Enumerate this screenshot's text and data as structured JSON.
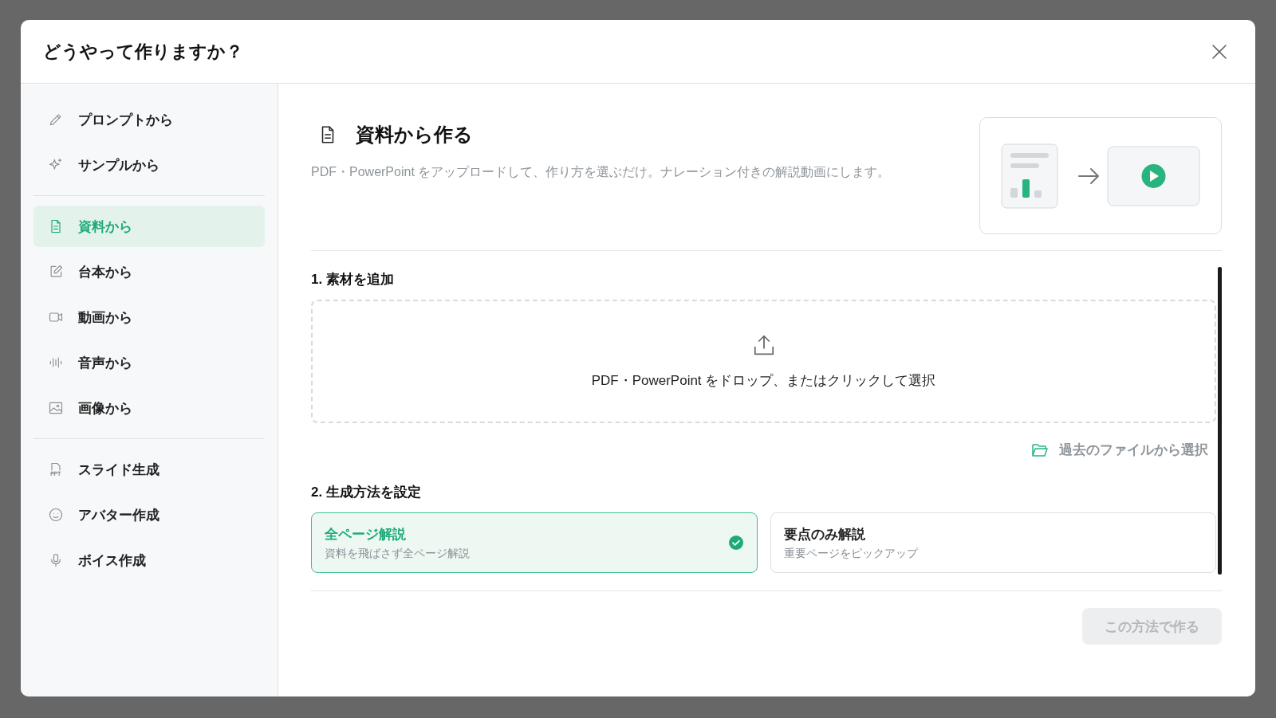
{
  "dialog": {
    "title": "どうやって作りますか？"
  },
  "sidebar": {
    "groups": [
      {
        "items": [
          {
            "label": "プロンプトから",
            "selected": false
          },
          {
            "label": "サンプルから",
            "selected": false
          }
        ]
      },
      {
        "items": [
          {
            "label": "資料から",
            "selected": true
          },
          {
            "label": "台本から",
            "selected": false
          },
          {
            "label": "動画から",
            "selected": false
          },
          {
            "label": "音声から",
            "selected": false
          },
          {
            "label": "画像から",
            "selected": false
          }
        ]
      },
      {
        "items": [
          {
            "label": "スライド生成",
            "selected": false
          },
          {
            "label": "アバター作成",
            "selected": false
          },
          {
            "label": "ボイス作成",
            "selected": false
          }
        ]
      }
    ]
  },
  "panel": {
    "title": "資料から作る",
    "description": "PDF・PowerPoint をアップロードして、作り方を選ぶだけ。ナレーション付きの解説動画にします。",
    "step_1": {
      "heading": "1. 素材を追加",
      "dropzone": "PDF・PowerPoint をドロップ、またはクリックして選択",
      "history_link": "過去のファイルから選択"
    },
    "step_2": {
      "heading": "2. 生成方法を設定",
      "methods": [
        {
          "title": "全ページ解説",
          "subtitle": "資料を飛ばさず全ページ解説",
          "selected": true
        },
        {
          "title": "要点のみ解説",
          "subtitle": "重要ページをピックアップ",
          "selected": false
        }
      ]
    },
    "submit": {
      "label": "この方法で作る",
      "disabled": true
    }
  }
}
